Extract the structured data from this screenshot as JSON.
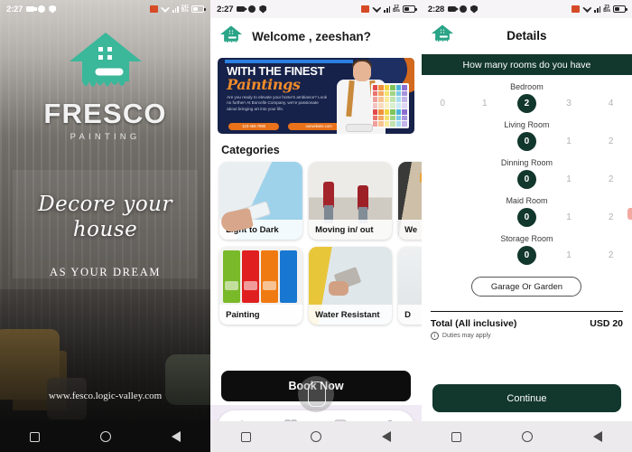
{
  "screens": {
    "splash": {
      "status": {
        "time": "2:27",
        "battery_rate": "241",
        "battery_unit": "B/s",
        "icons": [
          "video-icon",
          "moon-icon",
          "shield-icon",
          "cast-icon",
          "wifi-icon",
          "signal-icon",
          "battery-icon"
        ]
      },
      "brand_name": "FRESCO",
      "brand_sub": "PAINTING",
      "tagline_line1": "Decore your",
      "tagline_line2": "house",
      "tagline_dream": "AS YOUR DREAM",
      "url": "www.fesco.logic-valley.com"
    },
    "home": {
      "status": {
        "time": "2:27",
        "battery_rate": "12",
        "battery_unit": "B/s"
      },
      "welcome": "Welcome , zeeshan?",
      "banner": {
        "line1": "WITH THE FINEST",
        "line2": "Paintings",
        "paragraph": "Are you ready to elevate your home's ambiance? Look no further! At Borcelle Company, we're passionate about bringing art into your life.",
        "phone": "123-456-7890",
        "website": "ourwebsite.com"
      },
      "section_title": "Categories",
      "categories_row1": [
        {
          "label": "Light to Dark"
        },
        {
          "label": "Moving in/ out"
        },
        {
          "label": "We"
        }
      ],
      "categories_row2": [
        {
          "label": "Painting"
        },
        {
          "label": "Water Resistant"
        },
        {
          "label": "D"
        }
      ],
      "book_now": "Book Now",
      "tabs": [
        {
          "name": "home-icon"
        },
        {
          "name": "grid-icon"
        },
        {
          "name": "paint-roller-icon"
        },
        {
          "name": "profile-icon"
        }
      ]
    },
    "details": {
      "status": {
        "time": "2:28",
        "battery_rate": "23",
        "battery_unit": "B/s"
      },
      "title": "Details",
      "banner": "How many rooms do you have",
      "rooms": [
        {
          "name": "Bedroom",
          "options": [
            "0",
            "1",
            "2",
            "3",
            "4"
          ],
          "selected": 2
        },
        {
          "name": "Living Room",
          "options": [
            "0",
            "1",
            "2"
          ],
          "selected": 0
        },
        {
          "name": "Dinning Room",
          "options": [
            "0",
            "1",
            "2"
          ],
          "selected": 0
        },
        {
          "name": "Maid Room",
          "options": [
            "0",
            "1",
            "2"
          ],
          "selected": 0
        },
        {
          "name": "Storage Room",
          "options": [
            "0",
            "1",
            "2"
          ],
          "selected": 0
        }
      ],
      "garage_button": "Garage Or Garden",
      "total_label": "Total (All inclusive)",
      "total_value": "USD 20",
      "duties_note": "Duties may apply",
      "continue": "Continue"
    }
  },
  "colors": {
    "brand_teal": "#3bb79a",
    "dark_green": "#12372c",
    "banner_navy": "#16224a",
    "banner_orange": "#e8711a",
    "black_button": "#0d0d0d"
  }
}
